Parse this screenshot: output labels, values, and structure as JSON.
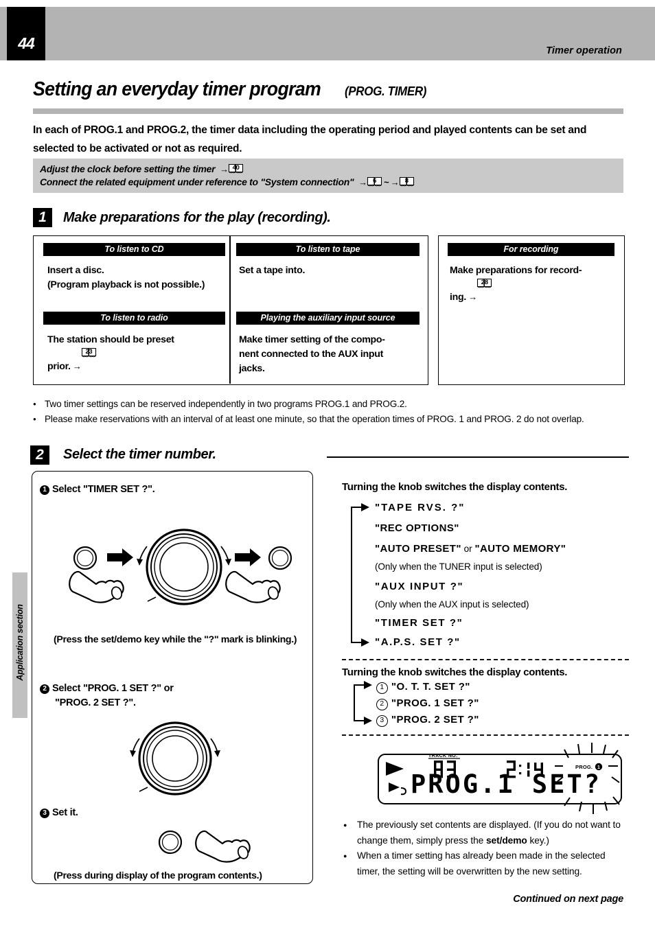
{
  "header": {
    "page_number": "44",
    "section_label": "Timer operation"
  },
  "title": {
    "main": "Setting an everyday timer program",
    "sub": "(PROG. TIMER)"
  },
  "intro": "In each of PROG.1 and PROG.2, the timer data including the operating period and played contents can be set and selected to be activated or not as required.",
  "notebox": {
    "line1": "Adjust the clock before setting the timer",
    "line1_ref": "40",
    "line2": "Connect the related equipment under reference to \"System connection\"",
    "line2_ref_from": "6",
    "line2_ref_to": "8",
    "tilde": "~"
  },
  "step1": {
    "number": "1",
    "title": "Make preparations for the play (recording).",
    "panels": [
      {
        "heading": "To listen to CD",
        "body": "Insert a disc.\n(Program playback is not possible.)"
      },
      {
        "heading": "To listen to tape",
        "body": "Set a tape into."
      },
      {
        "heading": "To listen to radio",
        "body": "The station should be preset\nprior.",
        "ref": "23"
      },
      {
        "heading": "Playing the auxiliary input source",
        "body": "Make timer setting of the compo-\nnent connected to the AUX input\njacks."
      },
      {
        "heading": "For recording",
        "body": "Make preparations for record-\ning.",
        "ref": "28"
      }
    ]
  },
  "bullets": [
    "Two timer settings can be reserved independently in two programs PROG.1 and PROG.2.",
    "Please make reservations with an interval of at least one minute, so that the operation times of PROG. 1 and PROG. 2 do not overlap."
  ],
  "step2": {
    "number": "2",
    "title": "Select the timer number.",
    "substeps": [
      {
        "badge": "1",
        "label": "Select \"TIMER SET ?\".",
        "note": "(Press the set/demo key while the \"?\" mark is blinking.)"
      },
      {
        "badge": "2",
        "label_line1": "Select \"PROG. 1  SET ?\" or",
        "label_line2": "\"PROG. 2 SET ?\"."
      },
      {
        "badge": "3",
        "label": "Set it.",
        "note": "(Press during display of the program contents.)"
      }
    ]
  },
  "right_column": {
    "list1_heading": "Turning the knob switches the display contents.",
    "list1_items": [
      {
        "text": "\"TAPE  RVS.  ?\"",
        "spaced": true
      },
      {
        "text": "\"REC OPTIONS\""
      },
      {
        "text": "\"AUTO PRESET\"",
        "or": " or ",
        "text2": "\"AUTO MEMORY\""
      },
      {
        "note": "(Only when the TUNER input is selected)"
      },
      {
        "text": "\"AUX INPUT ?\"",
        "spaced": true
      },
      {
        "note": "(Only when the AUX input is selected)"
      },
      {
        "text": "\"TIMER SET ?\"",
        "spaced": true
      },
      {
        "text": "\"A.P.S. SET ?\"",
        "spaced": true
      }
    ],
    "list2_heading": "Turning the knob switches the display contents.",
    "list2_items": [
      {
        "num": "1",
        "text": "\"O. T. T.  SET    ?\""
      },
      {
        "num": "2",
        "text": "\"PROG. 1  SET ?\""
      },
      {
        "num": "3",
        "text": "\"PROG. 2  SET ?\""
      }
    ]
  },
  "lcd": {
    "track_label": "TRACK NO.",
    "track_number": "03",
    "time": "2:14",
    "prog_indicator": "PROG.",
    "prog_number": "1",
    "main_text": "PROG.1 SET?"
  },
  "footer_notes": [
    {
      "pre": "The previously set contents are displayed. (If you do not want to change them, simply press the ",
      "bold": "set/demo",
      "post": " key.)"
    },
    {
      "pre": "When a timer setting has already been made in the selected timer, the setting will be overwritten by the new setting.",
      "bold": "",
      "post": ""
    }
  ],
  "continued": "Continued on next page",
  "side_tab": "Application section",
  "colors": {
    "header_gray": "#b3b3b3",
    "note_gray": "#c9c9c9",
    "tab_gray": "#c0c0c0",
    "black": "#000000"
  }
}
